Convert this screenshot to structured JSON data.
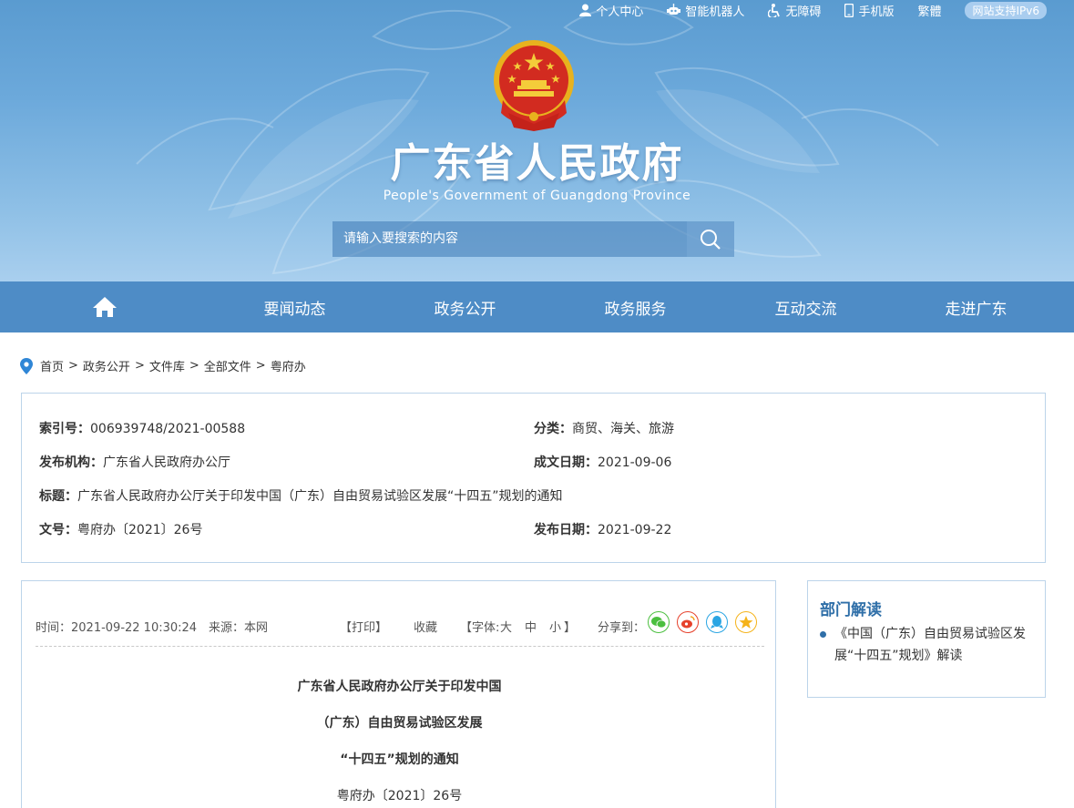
{
  "topbar": {
    "items": [
      {
        "label": "个人中心",
        "icon": "user-icon"
      },
      {
        "label": "智能机器人",
        "icon": "robot-icon"
      },
      {
        "label": "无障碍",
        "icon": "accessibility-icon"
      },
      {
        "label": "手机版",
        "icon": "mobile-icon"
      },
      {
        "label": "繁體",
        "icon": ""
      }
    ],
    "ipv6": "网站支持IPv6"
  },
  "header": {
    "title": "广东省人民政府",
    "subtitle": "People's Government of Guangdong Province",
    "emblem_icon": "national-emblem-icon"
  },
  "search": {
    "placeholder": "请输入要搜索的内容",
    "icon": "search-icon"
  },
  "nav": {
    "home_icon": "home-icon",
    "items": [
      "要闻动态",
      "政务公开",
      "政务服务",
      "互动交流",
      "走进广东"
    ]
  },
  "breadcrumb": {
    "icon": "location-pin-icon",
    "items": [
      "首页",
      "政务公开",
      "文件库",
      "全部文件",
      "粤府办"
    ],
    "separator": ">"
  },
  "info": {
    "index_label": "索引号：",
    "index_value": "006939748/2021-00588",
    "category_label": "分类：",
    "category_value": "商贸、海关、旅游",
    "publisher_label": "发布机构：",
    "publisher_value": "广东省人民政府办公厅",
    "written_label": "成文日期：",
    "written_value": "2021-09-06",
    "title_label": "标题：",
    "title_value": "广东省人民政府办公厅关于印发中国（广东）自由贸易试验区发展“十四五”规划的通知",
    "docno_label": "文号：",
    "docno_value": "粤府办〔2021〕26号",
    "pubdate_label": "发布日期：",
    "pubdate_value": "2021-09-22"
  },
  "article": {
    "time": "时间：2021-09-22 10:30:24",
    "source": "来源：本网",
    "print": "【打印】",
    "favorite": "收藏",
    "font_prefix": "【字体:",
    "font_large": "大",
    "font_medium": "中",
    "font_small": "小",
    "font_suffix": "】",
    "share_label": "分享到：",
    "share_icons": [
      {
        "icon": "wechat-icon",
        "color": "#4bbf3f"
      },
      {
        "icon": "weibo-icon",
        "color": "#e6412b"
      },
      {
        "icon": "qq-icon",
        "color": "#2aa5e3"
      },
      {
        "icon": "qzone-icon",
        "color": "#f5b31a"
      }
    ],
    "doc_title_lines": [
      "广东省人民政府办公厅关于印发中国",
      "（广东）自由贸易试验区发展",
      "“十四五”规划的通知"
    ],
    "doc_number": "粤府办〔2021〕26号"
  },
  "sidebar": {
    "heading": "部门解读",
    "items": [
      "《中国（广东）自由贸易试验区发展“十四五”规划》解读"
    ]
  },
  "colors": {
    "nav": "#4e8cc6",
    "accent": "#2f6fa8",
    "border": "#bcd4ea"
  }
}
